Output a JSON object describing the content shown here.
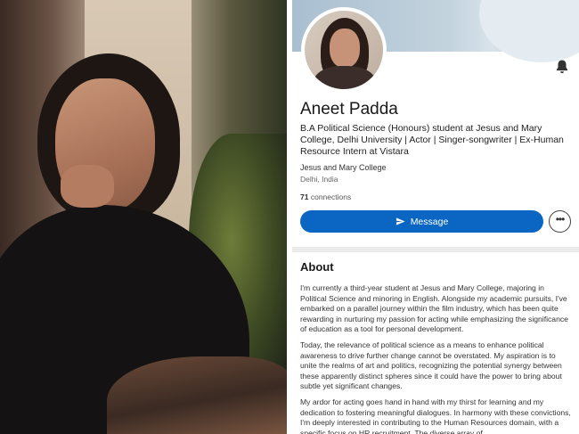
{
  "profile": {
    "name": "Aneet Padda",
    "headline": "B.A Political Science (Honours) student at Jesus and Mary College, Delhi University | Actor | Singer-songwriter | Ex-Human Resource Intern at Vistara",
    "school": "Jesus and Mary College",
    "location": "Delhi, India",
    "connections_count": "71",
    "connections_label": "connections"
  },
  "actions": {
    "message_label": "Message",
    "more_label": "•••"
  },
  "about": {
    "title": "About",
    "paragraphs": [
      "I'm currently a third-year student at Jesus and Mary College, majoring in Political Science and minoring in English. Alongside my academic pursuits, I've embarked on a parallel journey within the film industry, which has been quite rewarding in nurturing my passion for acting while emphasizing the significance of education as a tool for personal development.",
      "Today, the relevance of political science as a means to enhance political awareness to drive further change cannot be overstated. My aspiration is to unite the realms of art and politics, recognizing the potential synergy between these apparently distinct spheres since it could have the power to bring about subtle yet significant changes.",
      "My ardor for acting goes hand in hand with my thirst for learning and my dedication to fostering meaningful dialogues. In harmony with these convictions, I'm deeply interested in contributing to the Human Resources domain, with a specific focus on HR recruitment. The diverse array of"
    ]
  },
  "icons": {
    "notification": "bell-icon",
    "send": "send-icon",
    "more": "more-icon"
  },
  "colors": {
    "accent": "#0a66c2"
  }
}
